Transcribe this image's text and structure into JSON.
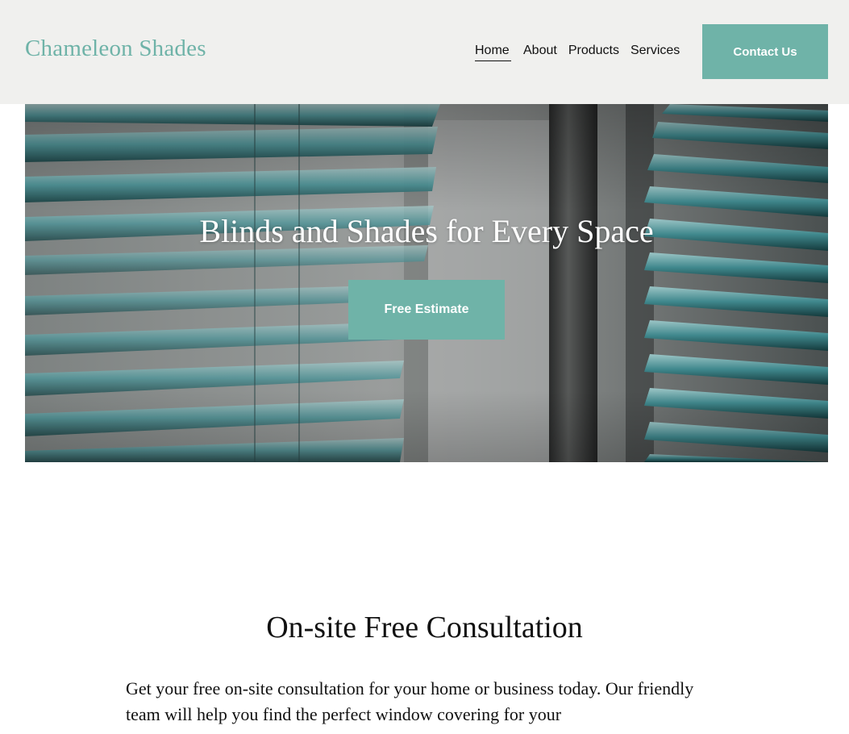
{
  "header": {
    "logo": "Chameleon Shades",
    "nav": [
      {
        "label": "Home",
        "active": true
      },
      {
        "label": "About",
        "active": false
      },
      {
        "label": "Products",
        "active": false
      },
      {
        "label": "Services",
        "active": false
      }
    ],
    "contact_button": "Contact Us"
  },
  "hero": {
    "title": "Blinds and Shades for Every Space",
    "cta_button": "Free Estimate"
  },
  "consultation": {
    "title": "On-site Free Consultation",
    "body": "Get your free on-site consultation for your home or business today. Our friendly team will help you find the perfect window covering for your"
  },
  "colors": {
    "accent": "#6fb3a8",
    "header_bg": "#f0f0ee",
    "slat_teal": "#3f8f94"
  }
}
